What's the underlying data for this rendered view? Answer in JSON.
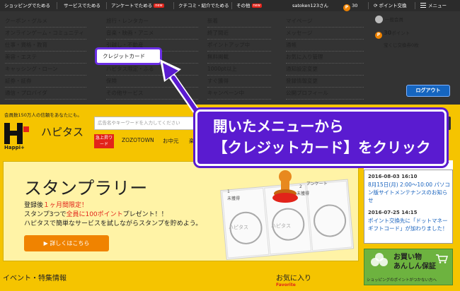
{
  "topbar": {
    "items": [
      {
        "label": "ショッピングでためる"
      },
      {
        "label": "サービスでためる"
      },
      {
        "label": "アンケートでためる",
        "badge": "new"
      },
      {
        "label": "クチコミ・紹介でためる"
      },
      {
        "label": "その他",
        "badge": "new"
      }
    ],
    "username": "satoken123さん",
    "points": "30",
    "point_exchange": "ポイント交換",
    "menu": "メニュー"
  },
  "mega_menu": {
    "col1": [
      "クーポン・グルメ",
      "オンラインゲーム・コミュニティ",
      "仕事・資格・教育",
      "美容・エステ",
      "キャッシング・ローン",
      "証券・証券",
      "通信・プロバイダ"
    ],
    "col2": [
      "旅行・レンタカー",
      "音楽・映画・アニメ",
      "引越し・不動産",
      "クレジットカード",
      "ハピタス限定・ふる",
      "保険",
      "その他サービス"
    ],
    "col3": [
      "新着",
      "終了間近",
      "ポイントアップ中",
      "無料掲載",
      "1000pt以上",
      "すぐ獲得",
      "キャンペーン中"
    ],
    "col4": [
      "マイページ",
      "メッセージ",
      "通帳",
      "お気に入り管理",
      "通知設定変更",
      "登録情報変更",
      "公開プロフィール"
    ],
    "account": {
      "rank": "一般会員",
      "points": "30",
      "points_label": "ポイント",
      "lottery": "宝くじ交換券0枚",
      "logout": "ログアウト"
    }
  },
  "header": {
    "members": "会員数150万人の信頼をあなたにも。",
    "brand": "ハピタス",
    "brand_sub": "Happi+",
    "search_placeholder": "広告名やキーワードを入力してください",
    "rise_badge": "急上昇ワード",
    "quick_words": [
      "ZOZOTOWN",
      "お中元",
      "楽"
    ]
  },
  "callout": {
    "line1": "開いたメニューから",
    "line2": "【クレジットカード】をクリック"
  },
  "banner": {
    "title": "スタンプラリー",
    "line1_a": "登録後",
    "line1_b": "１ヶ月間限定！",
    "line2_a": "スタンプ3つで",
    "line2_b": "全員に100ポイント",
    "line2_c": "プレゼント！！",
    "line3": "ハピタスで簡単なサービスを試しながらスタンプを貯めよう。",
    "button": "詳しくはこちら",
    "stamp_card": {
      "labels": [
        "未獲得",
        "未獲得",
        "アンケート"
      ],
      "numbers": [
        "1",
        "2",
        "3"
      ],
      "seal": "ハピタス"
    }
  },
  "news": {
    "items": [
      {
        "date": "2016-08-03 16:10",
        "text": "8月15日(月) 2:00～10:00 パソコン版サイトメンテナンスのお知らせ"
      },
      {
        "date": "2016-07-25 14:15",
        "text": "ポイント交換先に「ドットマネーギフトコード」が加わりました！"
      }
    ]
  },
  "guarantee": {
    "title_line1": "お買い物",
    "title_line2": "あんしん保証",
    "sub": "ショッピングのポイントがつかない方へ"
  },
  "footer": {
    "events": "イベント・特集情報",
    "favorites": "お気に入り",
    "favorites_en": "Favorite"
  },
  "colors": {
    "yellow": "#f5c400",
    "menu_dark": "#333333",
    "purple": "#5a1bd0",
    "orange": "#f08300",
    "red": "#e2231a",
    "blue": "#1565c0"
  }
}
